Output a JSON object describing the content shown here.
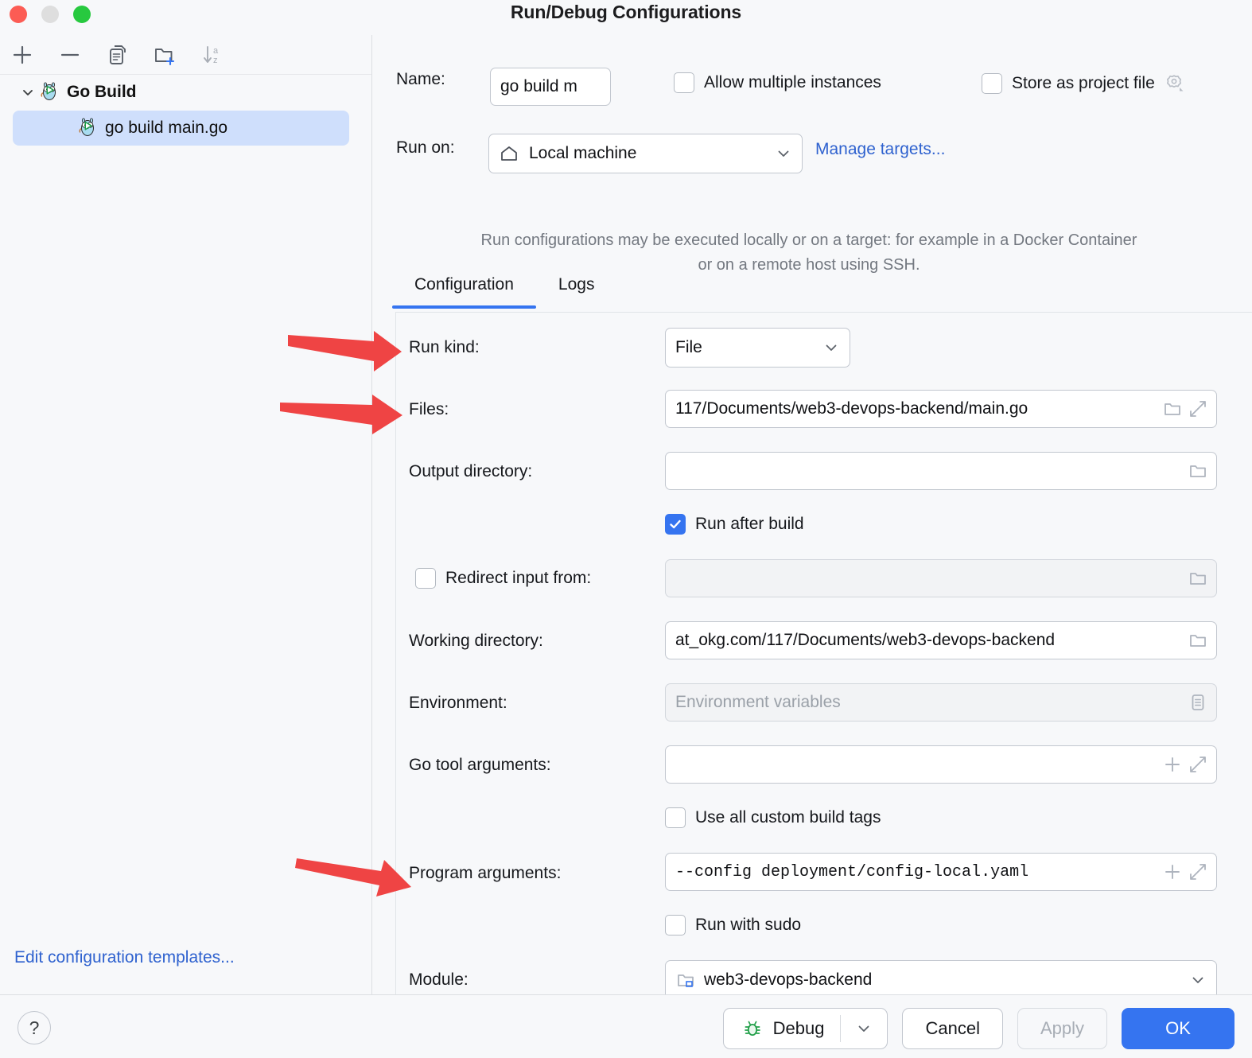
{
  "window": {
    "title": "Run/Debug Configurations",
    "traffic_lights": [
      "close",
      "minimize",
      "zoom"
    ]
  },
  "sidebar": {
    "toolbar": [
      {
        "name": "add-icon",
        "glyph": "+"
      },
      {
        "name": "remove-icon",
        "glyph": "−"
      },
      {
        "name": "copy-icon",
        "glyph": "copy"
      },
      {
        "name": "new-folder-icon",
        "glyph": "folder-plus"
      },
      {
        "name": "sort-alphabetically-icon",
        "glyph": "sort-az"
      }
    ],
    "tree": [
      {
        "label": "Go Build",
        "type": "group",
        "expanded": true,
        "icon": "go-gopher-icon"
      },
      {
        "label": "go build main.go",
        "type": "configuration",
        "selected": true,
        "icon": "go-gopher-icon"
      }
    ],
    "edit_templates_link": "Edit configuration templates..."
  },
  "form": {
    "name_label": "Name:",
    "name_value": "go build m",
    "allow_multiple_instances_label": "Allow multiple instances",
    "allow_multiple_instances_checked": false,
    "store_as_project_file_label": "Store as project file",
    "store_as_project_file_checked": false,
    "store_gear_icon": "gear-icon",
    "run_on_label": "Run on:",
    "run_on_value": "Local machine",
    "run_on_icon": "home-icon",
    "manage_targets_link": "Manage targets...",
    "hint_text": "Run configurations may be executed locally or on a target: for example in a Docker Container or on a remote host using SSH.",
    "tabs": [
      {
        "label": "Configuration",
        "active": true
      },
      {
        "label": "Logs",
        "active": false
      }
    ],
    "run_kind_label": "Run kind:",
    "run_kind_value": "File",
    "files_label": "Files:",
    "files_value": "117/Documents/web3-devops-backend/main.go",
    "output_directory_label": "Output directory:",
    "output_directory_value": "",
    "run_after_build_label": "Run after build",
    "run_after_build_checked": true,
    "redirect_input_label": "Redirect input from:",
    "redirect_input_checked": false,
    "redirect_input_value": "",
    "working_directory_label": "Working directory:",
    "working_directory_value": "at_okg.com/117/Documents/web3-devops-backend",
    "environment_label": "Environment:",
    "environment_placeholder": "Environment variables",
    "environment_value": "",
    "go_tool_arguments_label": "Go tool arguments:",
    "go_tool_arguments_value": "",
    "use_all_custom_build_tags_label": "Use all custom build tags",
    "use_all_custom_build_tags_checked": false,
    "program_arguments_label": "Program arguments:",
    "program_arguments_value": "--config deployment/config-local.yaml",
    "run_with_sudo_label": "Run with sudo",
    "run_with_sudo_checked": false,
    "module_label": "Module:",
    "module_value": "web3-devops-backend",
    "module_icon": "module-folder-icon"
  },
  "footer": {
    "help_label": "?",
    "debug_label": "Debug",
    "debug_icon": "bug-icon",
    "cancel_label": "Cancel",
    "apply_label": "Apply",
    "apply_disabled": true,
    "ok_label": "OK"
  },
  "annotations": {
    "arrow_color": "#ef4444",
    "arrows": [
      {
        "target": "run-kind-label"
      },
      {
        "target": "files-label"
      },
      {
        "target": "program-arguments-label"
      }
    ]
  },
  "colors": {
    "accent": "#3574f0",
    "link": "#2f62cf",
    "selection": "#cfdffc",
    "background": "#f7f8fa",
    "arrow": "#ef4444"
  }
}
